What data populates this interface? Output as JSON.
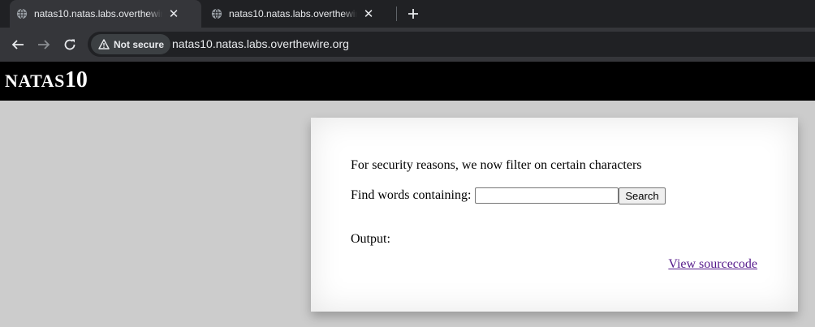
{
  "browser": {
    "tabs": [
      {
        "title": "natas10.natas.labs.overthewire.org",
        "active": true
      },
      {
        "title": "natas10.natas.labs.overthewire.org",
        "active": false
      }
    ],
    "security_chip": "Not secure",
    "url": "natas10.natas.labs.overthewire.org"
  },
  "page": {
    "header_prefix": "NATAS",
    "header_number": "10",
    "notice": "For security reasons, we now filter on certain characters",
    "find_label": "Find words containing:",
    "needle_value": "",
    "search_button": "Search",
    "output_label": "Output:",
    "view_source": "View sourcecode"
  }
}
